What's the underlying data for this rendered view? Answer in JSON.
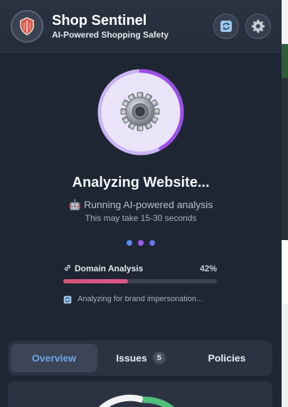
{
  "header": {
    "title": "Shop Sentinel",
    "subtitle": "AI-Powered Shopping Safety",
    "refresh_icon": "refresh-icon",
    "settings_icon": "gear-icon",
    "logo_icon": "shield-icon"
  },
  "analysis": {
    "progress_fraction": 0.42,
    "title": "Analyzing Website...",
    "status": "🤖 Running AI-powered analysis",
    "note": "This may take 15-30 seconds",
    "step_label": "Domain Analysis",
    "step_percent_text": "42%",
    "step_progress": 0.42,
    "substep": "Analyzing for brand impersonation..."
  },
  "tabs": [
    {
      "label": "Overview",
      "active": true
    },
    {
      "label": "Issues",
      "badge": "5",
      "active": false
    },
    {
      "label": "Policies",
      "active": false
    }
  ],
  "colors": {
    "accent_blue": "#6fa5e8",
    "accent_purple": "#a855f7",
    "progress_pink": "#e0578a",
    "score_green": "#4fbf7a"
  }
}
